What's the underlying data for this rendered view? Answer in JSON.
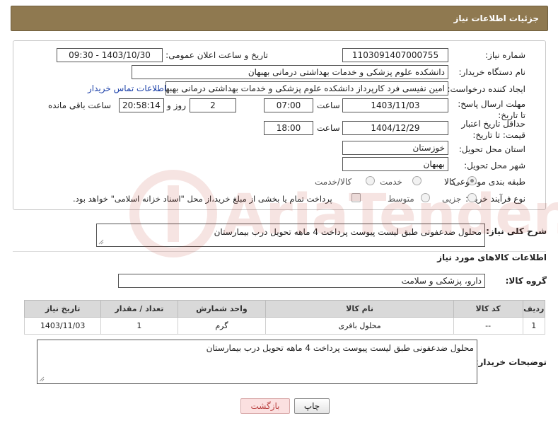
{
  "header": {
    "title": "جزئیات اطلاعات نیاز"
  },
  "form": {
    "need_number": {
      "label": "شماره نیاز:",
      "value": "1103091407000755"
    },
    "announce": {
      "label": "تاریخ و ساعت اعلان عمومی:",
      "value": "1403/10/30 - 09:30"
    },
    "buyer_org": {
      "label": "نام دستگاه خریدار:",
      "value": "دانشکده علوم پزشکی و خدمات بهداشتی  درمانی بهبهان"
    },
    "requester": {
      "label": "ایجاد کننده درخواست:",
      "value": "امین نفیسی فرد کارپرداز دانشکده علوم پزشکی و خدمات بهداشتی  درمانی بهبهان",
      "contact_link": "اطلاعات تماس خریدار"
    },
    "deadline": {
      "label": "مهلت ارسال پاسخ: تا تاریخ:",
      "date": "1403/11/03",
      "time_label": "ساعت",
      "time": "07:00",
      "days": "2",
      "days_label": "روز و",
      "remaining": "20:58:14",
      "remaining_label": "ساعت باقی مانده"
    },
    "price_validity": {
      "label": "حداقل تاریخ اعتبار قیمت: تا تاریخ:",
      "date": "1404/12/29",
      "time_label": "ساعت",
      "time": "18:00"
    },
    "province": {
      "label": "استان محل تحویل:",
      "value": "خوزستان"
    },
    "city": {
      "label": "شهر محل تحویل:",
      "value": "بهبهان"
    },
    "category": {
      "label": "طبقه بندی موضوعی:",
      "options": [
        "کالا",
        "خدمت",
        "کالا/خدمت"
      ],
      "selected": "کالا"
    },
    "process": {
      "label": "نوع فرآیند خرید :",
      "options": [
        "جزیی",
        "متوسط"
      ],
      "note": "پرداخت تمام یا بخشی از مبلغ خرید،از محل \"اسناد خزانه اسلامی\" خواهد بود."
    }
  },
  "description": {
    "label": "شرح کلی نیاز:",
    "value": "محلول ضدعفونی طبق لیست پیوست پرداخت 4 ماهه تحویل درب بیمارستان"
  },
  "goods_section": {
    "title": "اطلاعات کالاهای مورد نیاز"
  },
  "goods_group": {
    "label": "گروه کالا:",
    "value": "دارو، پزشکی و سلامت"
  },
  "table": {
    "headers": [
      "ردیف",
      "کد کالا",
      "نام کالا",
      "واحد شمارش",
      "تعداد / مقدار",
      "تاریخ نیاز"
    ],
    "rows": [
      [
        "1",
        "--",
        "محلول بافری",
        "گرم",
        "1",
        "1403/11/03"
      ]
    ]
  },
  "buyer_notes": {
    "label": "توضیحات خریدار:",
    "value": "محلول ضدعفونی طبق لیست پیوست پرداخت 4 ماهه تحویل درب بیمارستان"
  },
  "buttons": {
    "print": "چاپ",
    "back": "بازگشت"
  },
  "watermark": {
    "text": "AriaTender.neT"
  },
  "colors": {
    "header_bg": "#8f7950",
    "link": "#1a3fa8",
    "back_btn": "#fbe0e0",
    "watermark": "#c0392b"
  }
}
